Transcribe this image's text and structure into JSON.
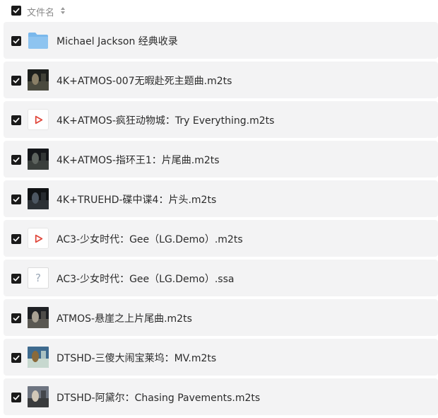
{
  "header": {
    "checkbox_checked": true,
    "column_label": "文件名",
    "sort_icon": "sort-updown-icon"
  },
  "colors": {
    "row_bg": "#f3f3f4",
    "checkbox": "#1a1a1a",
    "folder": "#7ab8ec",
    "play": "#e0463a"
  },
  "files": [
    {
      "name": "Michael Jackson 经典收录",
      "type": "folder",
      "icon": "folder-icon",
      "checked": true
    },
    {
      "name": "4K+ATMOS-007无暇赴死主题曲.m2ts",
      "type": "video-thumbnail",
      "icon": "video-thumbnail",
      "checked": true
    },
    {
      "name": "4K+ATMOS-疯狂动物城：Try Everything.m2ts",
      "type": "video",
      "icon": "play-icon",
      "checked": true
    },
    {
      "name": "4K+ATMOS-指环王1：片尾曲.m2ts",
      "type": "video-thumbnail",
      "icon": "video-thumbnail",
      "checked": true
    },
    {
      "name": "4K+TRUEHD-碟中谍4：片头.m2ts",
      "type": "video-thumbnail",
      "icon": "video-thumbnail",
      "checked": true
    },
    {
      "name": "AC3-少女时代：Gee（LG.Demo）.m2ts",
      "type": "video",
      "icon": "play-icon",
      "checked": true
    },
    {
      "name": "AC3-少女时代：Gee（LG.Demo）.ssa",
      "type": "unknown",
      "icon": "unknown-file-icon",
      "checked": true
    },
    {
      "name": "ATMOS-悬崖之上片尾曲.m2ts",
      "type": "video-thumbnail",
      "icon": "video-thumbnail",
      "checked": true
    },
    {
      "name": "DTSHD-三傻大闹宝莱坞：MV.m2ts",
      "type": "video-thumbnail",
      "icon": "video-thumbnail",
      "checked": true
    },
    {
      "name": "DTSHD-阿黛尔：Chasing Pavements.m2ts",
      "type": "video-thumbnail",
      "icon": "video-thumbnail",
      "checked": true
    }
  ]
}
